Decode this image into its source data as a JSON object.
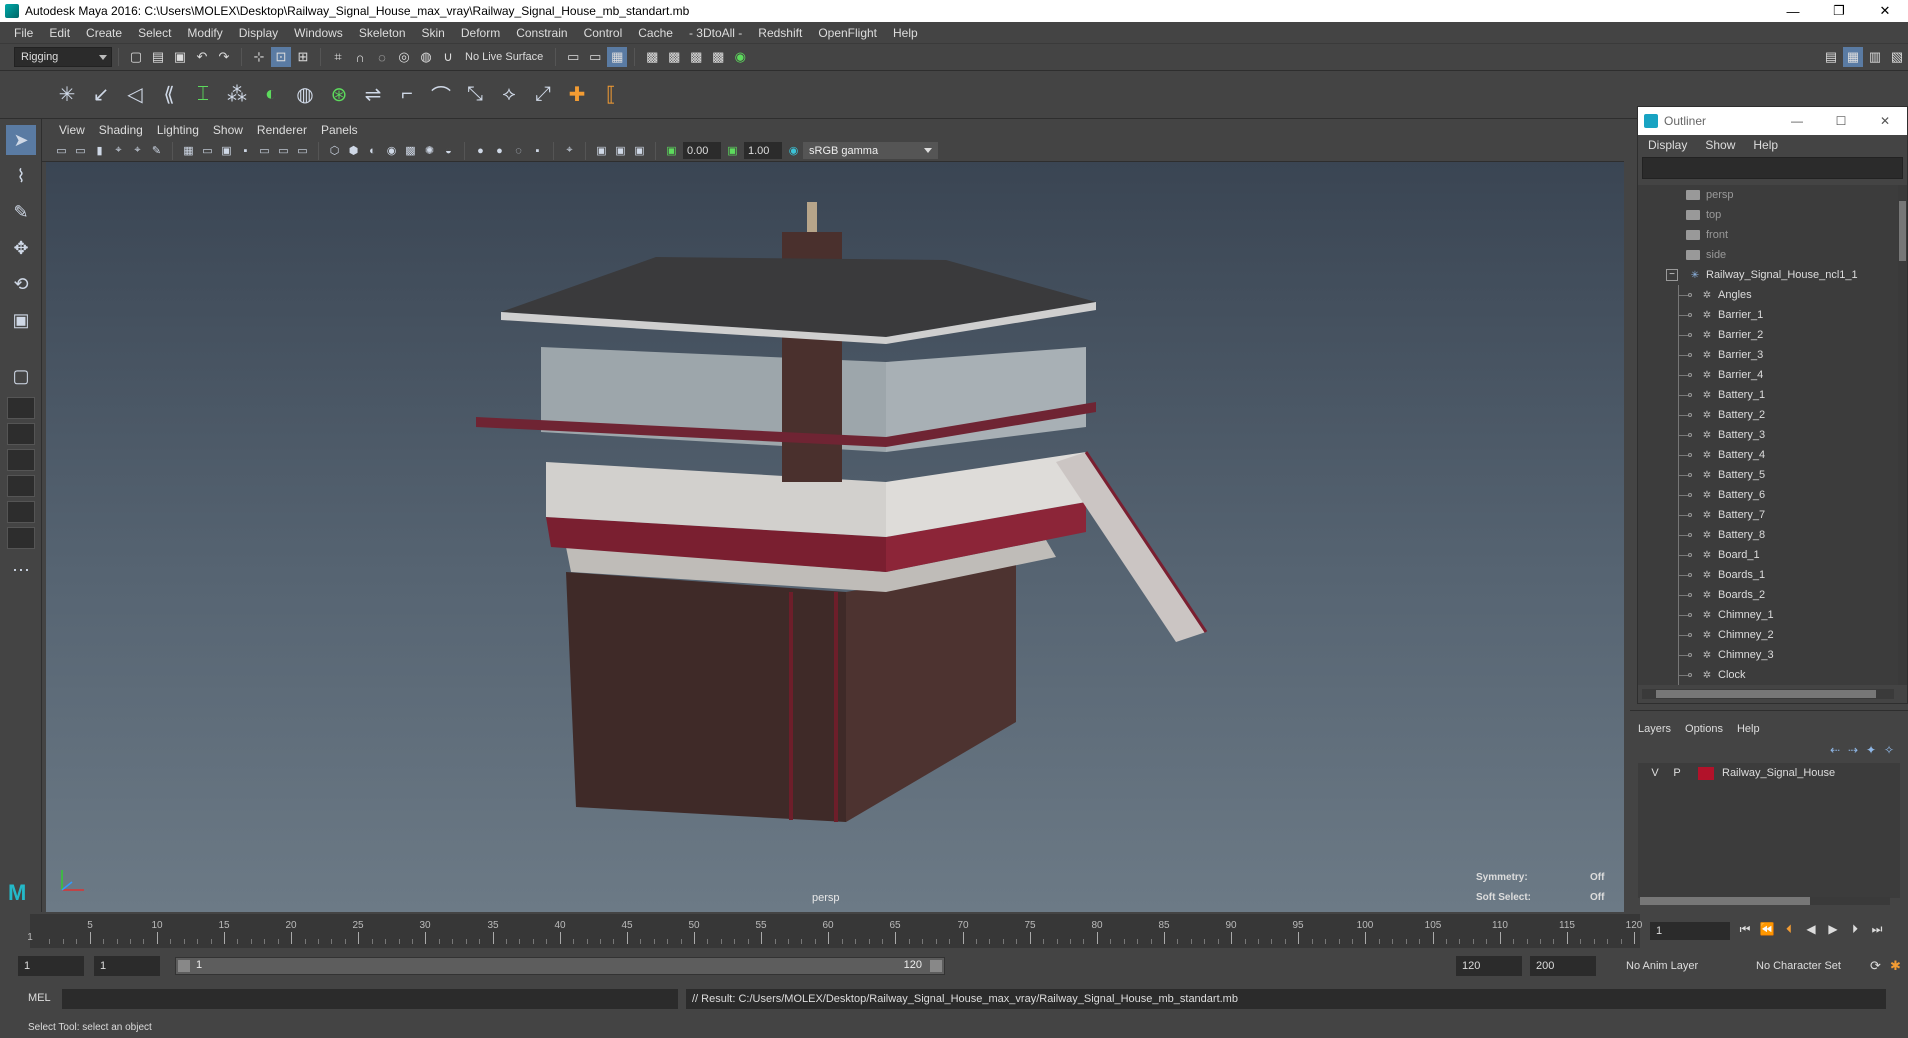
{
  "window": {
    "title": "Autodesk Maya 2016: C:\\Users\\MOLEX\\Desktop\\Railway_Signal_House_max_vray\\Railway_Signal_House_mb_standart.mb",
    "minimize": "—",
    "maximize": "❐",
    "close": "✕"
  },
  "menubar": [
    "File",
    "Edit",
    "Create",
    "Select",
    "Modify",
    "Display",
    "Windows",
    "Skeleton",
    "Skin",
    "Deform",
    "Constrain",
    "Control",
    "Cache",
    "- 3DtoAll -",
    "Redshift",
    "OpenFlight",
    "Help"
  ],
  "statusline": {
    "mode": "Rigging",
    "live_surface": "No Live Surface"
  },
  "viewport": {
    "menu": [
      "View",
      "Shading",
      "Lighting",
      "Show",
      "Renderer",
      "Panels"
    ],
    "near_value": "0.00",
    "far_value": "1.00",
    "color_space": "sRGB gamma",
    "camera_label": "persp",
    "symmetry_label": "Symmetry:",
    "symmetry_value": "Off",
    "soft_select_label": "Soft Select:",
    "soft_select_value": "Off"
  },
  "outliner": {
    "title": "Outliner",
    "menu": [
      "Display",
      "Show",
      "Help"
    ],
    "cameras": [
      "persp",
      "top",
      "front",
      "side"
    ],
    "group": "Railway_Signal_House_ncl1_1",
    "children": [
      "Angles",
      "Barrier_1",
      "Barrier_2",
      "Barrier_3",
      "Barrier_4",
      "Battery_1",
      "Battery_2",
      "Battery_3",
      "Battery_4",
      "Battery_5",
      "Battery_6",
      "Battery_7",
      "Battery_8",
      "Board_1",
      "Boards_1",
      "Boards_2",
      "Chimney_1",
      "Chimney_2",
      "Chimney_3",
      "Clock"
    ]
  },
  "layers": {
    "menu": [
      "Layers",
      "Options",
      "Help"
    ],
    "layer": {
      "v": "V",
      "p": "P",
      "name": "Railway_Signal_House",
      "color": "#b2122a"
    }
  },
  "timeline": {
    "start_marker": "1",
    "ticks": [
      5,
      10,
      15,
      20,
      25,
      30,
      35,
      40,
      45,
      50,
      55,
      60,
      65,
      70,
      75,
      80,
      85,
      90,
      95,
      100,
      105,
      110,
      115,
      120
    ],
    "current_frame": "1"
  },
  "range": {
    "start": "1",
    "playback_start": "1",
    "bar_left": "1",
    "bar_right": "120",
    "playback_end": "120",
    "end": "200",
    "anim_layer": "No Anim Layer",
    "character_set": "No Character Set"
  },
  "cmdline": {
    "mode": "MEL",
    "result": "// Result: C:/Users/MOLEX/Desktop/Railway_Signal_House_max_vray/Railway_Signal_House_mb_standart.mb"
  },
  "helpline": "Select Tool: select an object"
}
